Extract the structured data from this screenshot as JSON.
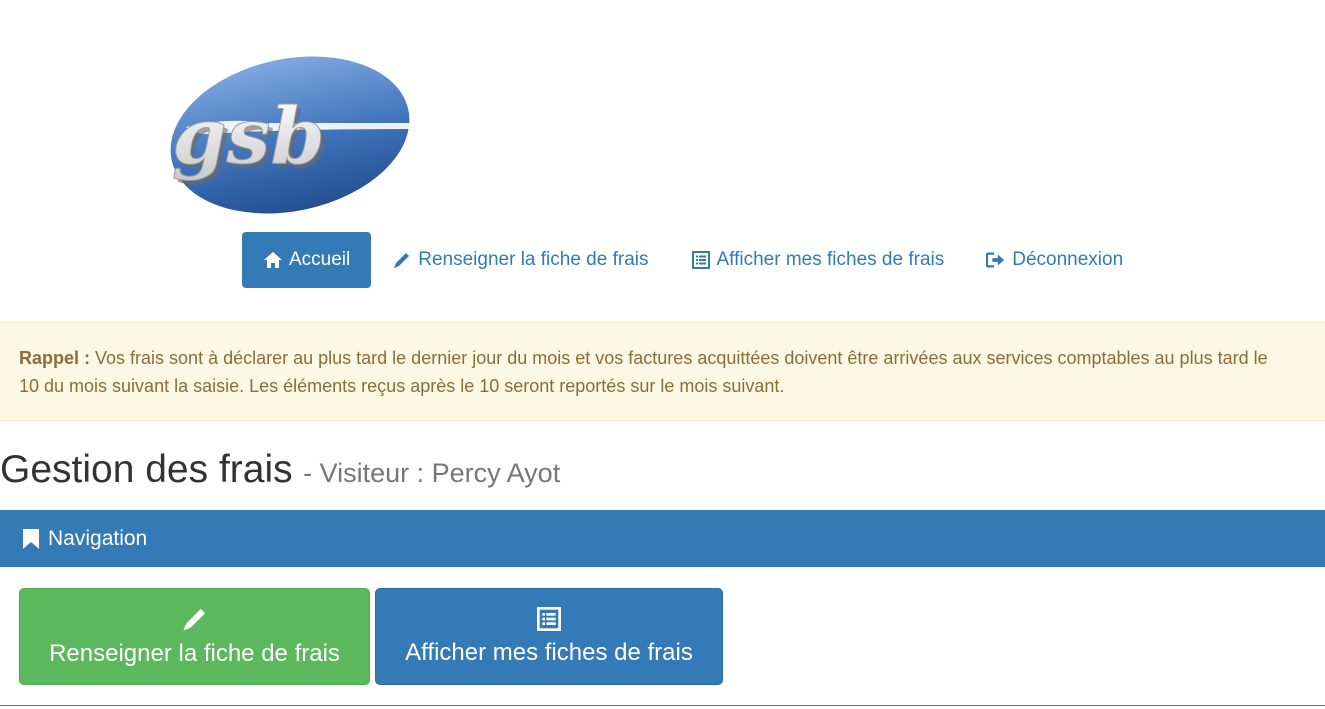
{
  "logo": {
    "text": "gsb",
    "icon": "gsb-logo"
  },
  "topnav": {
    "items": [
      {
        "label": "Accueil",
        "icon": "home-icon",
        "active": true
      },
      {
        "label": "Renseigner la fiche de frais",
        "icon": "pencil-icon",
        "active": false
      },
      {
        "label": "Afficher mes fiches de frais",
        "icon": "list-icon",
        "active": false
      },
      {
        "label": "Déconnexion",
        "icon": "logout-icon",
        "active": false
      }
    ]
  },
  "alert": {
    "strong": "Rappel :",
    "text": " Vos frais sont à déclarer au plus tard le dernier jour du mois et vos factures acquittées doivent être arrivées aux services comptables au plus tard le 10 du mois suivant la saisie. Les éléments reçus après le 10 seront reportés sur le mois suivant."
  },
  "heading": {
    "title": "Gestion des frais",
    "subtitle": "- Visiteur : Percy Ayot"
  },
  "panel": {
    "title": "Navigation",
    "icon": "bookmark-icon",
    "buttons": [
      {
        "label": "Renseigner la fiche de frais",
        "icon": "pencil-icon",
        "color": "#5cb85c"
      },
      {
        "label": "Afficher mes fiches de frais",
        "icon": "list-icon",
        "color": "#337ab7"
      }
    ]
  },
  "colors": {
    "primary": "#337ab7",
    "success": "#5cb85c",
    "warning_bg": "#fcf8e3",
    "warning_text": "#8a6d3b"
  }
}
